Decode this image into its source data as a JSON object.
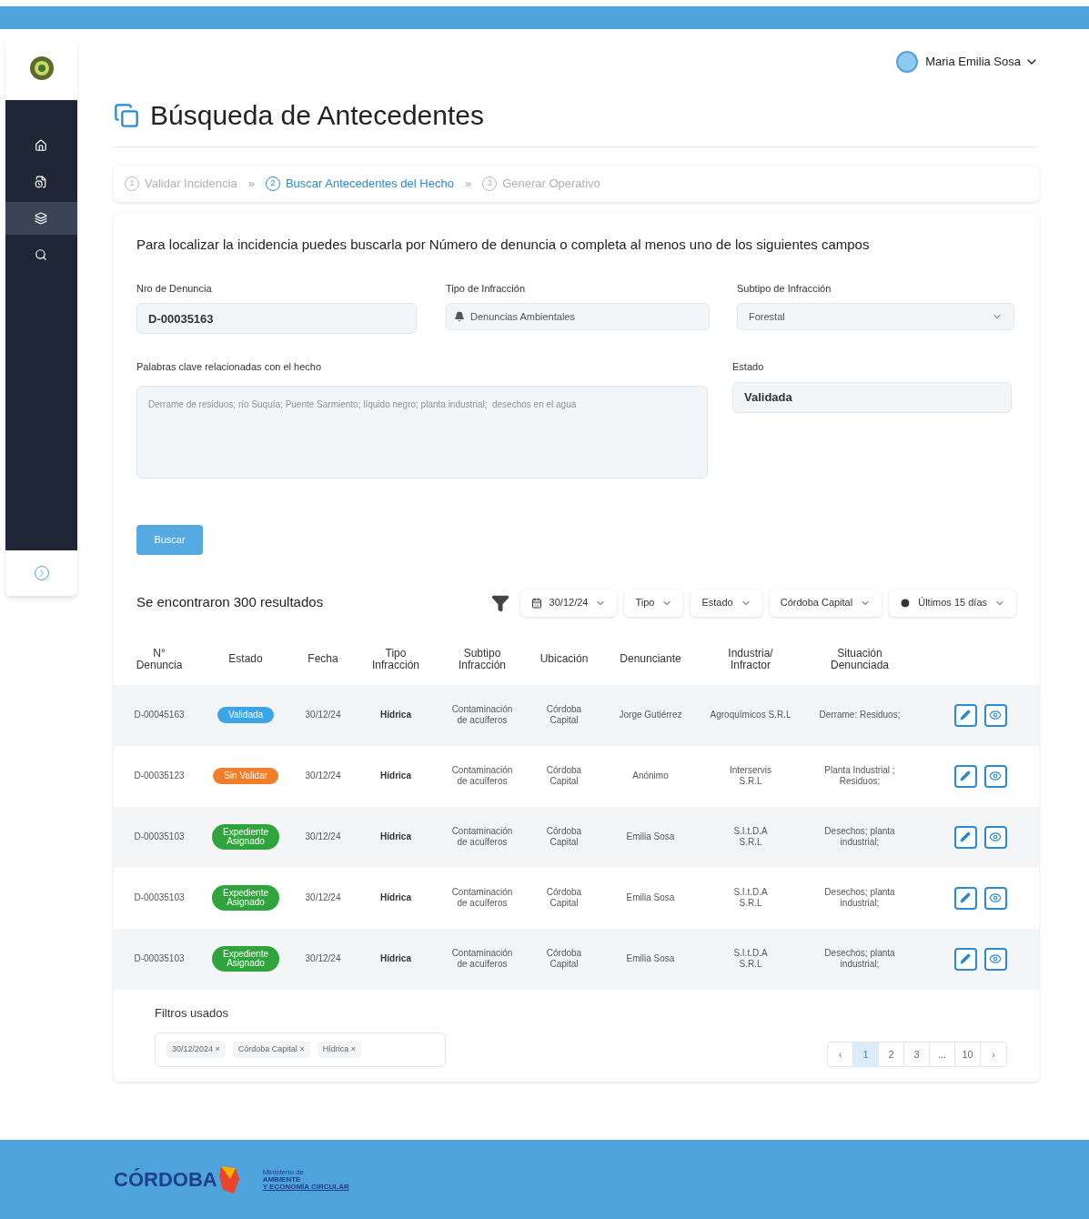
{
  "user": {
    "name": "Maria Emilia Sosa"
  },
  "sidebar": {
    "items": [
      {
        "selected": false
      },
      {
        "selected": false
      },
      {
        "selected": true
      },
      {
        "selected": false
      }
    ]
  },
  "page_title": "Búsqueda de Antecedentes",
  "steps": [
    {
      "number": "1",
      "label": "Validar Incidencia",
      "selected": false
    },
    {
      "number": "2",
      "label": "Buscar Antecedentes del Hecho",
      "selected": true
    },
    {
      "number": "3",
      "label": "Generar Operativo",
      "selected": false
    }
  ],
  "step_separator": "»",
  "intro": "Para  localizar la incidencia puedes buscarla por Número de denuncia o completa al menos uno de los siguientes campos",
  "form": {
    "nro": {
      "label": "Nro de Denuncia",
      "value": "D-00035163"
    },
    "tipo": {
      "label": "Tipo de Infracción",
      "value": "Denuncias Ambientales"
    },
    "subtipo": {
      "label": "Subtipo de Infracción",
      "value": "Forestal"
    },
    "keywords": {
      "label": "Palabras clave relacionadas con el hecho",
      "placeholder": "Derrame de residuos; río Suquía; Puente Sarmiento; líquido negro; planta industrial;  desechos en el agua"
    },
    "estado": {
      "label": "Estado",
      "value": "Validada"
    },
    "submit": "Buscar"
  },
  "results": {
    "summary": "Se encontraron 300 resultados",
    "filters": [
      {
        "kind": "date",
        "label": "30/12/24"
      },
      {
        "kind": "plain",
        "label": "Tipo"
      },
      {
        "kind": "plain",
        "label": "Estado"
      },
      {
        "kind": "plain",
        "label": "Córdoba Capital"
      },
      {
        "kind": "time",
        "label": "Últimos 15 días"
      }
    ]
  },
  "table": {
    "columns": [
      "N°\nDenuncia",
      "Estado",
      "Fecha",
      "Tipo\nInfracción",
      "Subtipo\nInfracción",
      "Ubicación",
      "Denunciante",
      "Industria/\nInfractor",
      "Situación\nDenunciada"
    ],
    "rows": [
      {
        "nro": "D-00045163",
        "status": "Validada",
        "color": "#3aa6e8",
        "fecha": "30/12/24",
        "tipo": "Hídrica",
        "subtipo": "Contaminación\nde acuíferos",
        "ubicacion": "Córdoba\nCapital",
        "denunciante": "Jorge Gutiérrez",
        "industria": "Agroquímicos S.R.L",
        "situacion": "Derrame:  Residuos;"
      },
      {
        "nro": "D-00035123",
        "status": "Sin Validar",
        "color": "#ef7f2a",
        "fecha": "30/12/24",
        "tipo": "Hídrica",
        "subtipo": "Contaminación\nde acuíferos",
        "ubicacion": "Córdoba\nCapital",
        "denunciante": "Anónimo",
        "industria": "Interservis\nS.R.L",
        "situacion": "Planta Industrial ;\nResiduos;"
      },
      {
        "nro": "D-00035103",
        "status": "Expediente\nAsignado",
        "color": "#2fa43c",
        "fecha": "30/12/24",
        "tipo": "Hídrica",
        "subtipo": "Contaminación\nde acuíferos",
        "ubicacion": "Córdoba\nCapital",
        "denunciante": "Emilia Sosa",
        "industria": "S.I.t.D.A\nS.R.L",
        "situacion": "Desechos; planta\nindustrial;"
      },
      {
        "nro": "D-00035103",
        "status": "Expediente\nAsignado",
        "color": "#2fa43c",
        "fecha": "30/12/24",
        "tipo": "Hídrica",
        "subtipo": "Contaminación\nde acuíferos",
        "ubicacion": "Córdoba\nCapital",
        "denunciante": "Emilia Sosa",
        "industria": "S.I.t.D.A\nS.R.L",
        "situacion": "Desechos; planta\nindustrial;"
      },
      {
        "nro": "D-00035103",
        "status": "Expediente\nAsignado",
        "color": "#2fa43c",
        "fecha": "30/12/24",
        "tipo": "Hídrica",
        "subtipo": "Contaminación\nde acuíferos",
        "ubicacion": "Córdoba\nCapital",
        "denunciante": "Emilia Sosa",
        "industria": "S.I.t.D.A\nS.R.L",
        "situacion": "Desechos; planta\nindustrial;"
      }
    ]
  },
  "used_filters": {
    "title": "Filtros usados",
    "tags": [
      "30/12/2024",
      "Córdoba Capital",
      "Hídrica"
    ],
    "remove_symbol": "×"
  },
  "pagination": {
    "prev": "‹",
    "next": "›",
    "pages": [
      {
        "label": "1",
        "selected": true
      },
      {
        "label": "2",
        "selected": false
      },
      {
        "label": "3",
        "selected": false
      },
      {
        "label": "...",
        "selected": false
      },
      {
        "label": "10",
        "selected": false
      }
    ]
  },
  "footer": {
    "brand": "CÓRDOBA",
    "ministry": [
      "Ministerio de",
      "AMBIENTE",
      "Y ECONOMÍA CIRCULAR"
    ]
  }
}
